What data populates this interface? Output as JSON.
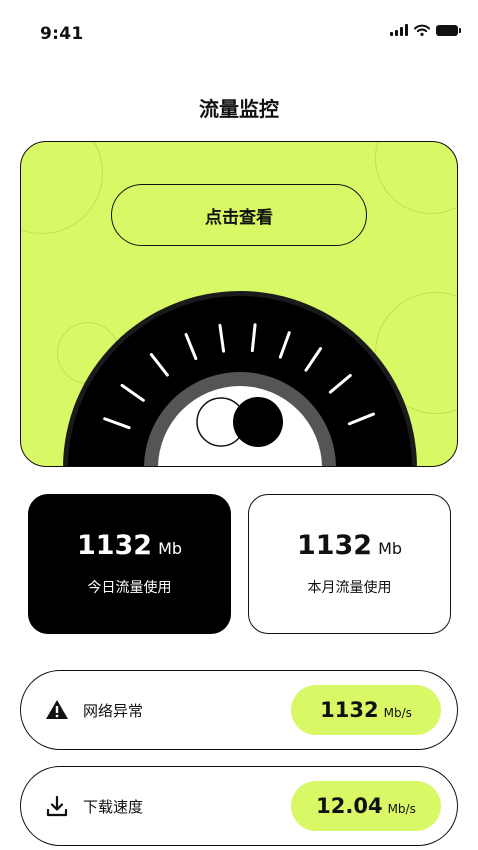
{
  "status_bar": {
    "time": "9:41"
  },
  "header": {
    "title": "流量监控"
  },
  "hero": {
    "view_button_label": "点击查看"
  },
  "stats": [
    {
      "value": "1132",
      "unit": "Mb",
      "label": "今日流量使用"
    },
    {
      "value": "1132",
      "unit": "Mb",
      "label": "本月流量使用"
    }
  ],
  "metrics": [
    {
      "icon": "warning-icon",
      "label": "网络异常",
      "value": "1132",
      "unit": "Mb/s"
    },
    {
      "icon": "download-icon",
      "label": "下载速度",
      "value": "12.04",
      "unit": "Mb/s"
    }
  ],
  "colors": {
    "accent": "#d9f866",
    "dark": "#000000",
    "text": "#111111"
  }
}
